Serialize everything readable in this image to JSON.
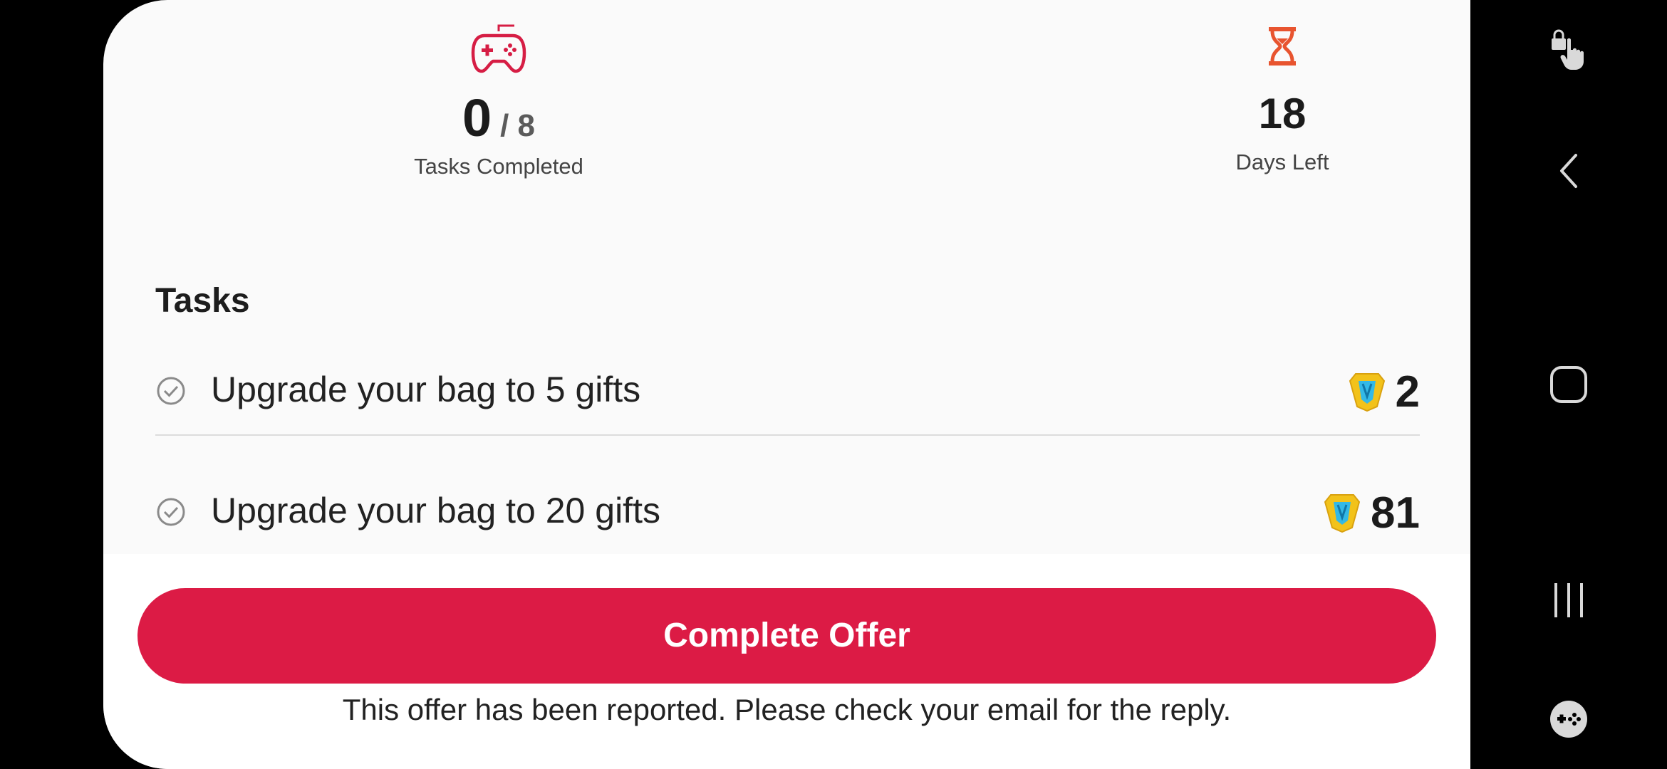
{
  "stats": {
    "tasks_completed": {
      "value": "0",
      "total": "/ 8",
      "label": "Tasks Completed",
      "icon": "gamepad-icon"
    },
    "days_left": {
      "value": "18",
      "label": "Days Left",
      "icon": "hourglass-icon"
    }
  },
  "tasks": {
    "title": "Tasks",
    "items": [
      {
        "label": "Upgrade your bag to 5 gifts",
        "reward": "2",
        "reward_icon": "gem-icon"
      },
      {
        "label": "Upgrade your bag to 20 gifts",
        "reward": "81",
        "reward_icon": "gem-icon"
      }
    ]
  },
  "footer": {
    "cta_label": "Complete Offer",
    "notice": "This offer has been reported. Please check your email for the reply."
  },
  "navbar": {
    "icons": [
      "lock-touch-icon",
      "back-icon",
      "home-icon",
      "recents-icon",
      "game-launcher-icon"
    ]
  },
  "colors": {
    "accent": "#dc1b45",
    "hourglass": "#e8542f",
    "background": "#fafafa"
  }
}
